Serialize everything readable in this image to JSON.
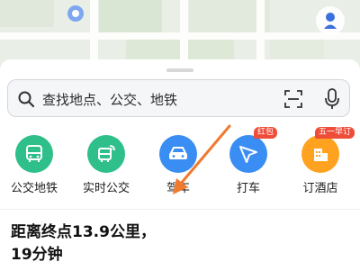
{
  "search": {
    "placeholder": "查找地点、公交、地铁"
  },
  "actions": [
    {
      "label": "公交地铁",
      "icon": "bus-icon",
      "color": "#2fbf8b"
    },
    {
      "label": "实时公交",
      "icon": "realtime-bus-icon",
      "color": "#2fbf8b"
    },
    {
      "label": "驾车",
      "icon": "car-icon",
      "color": "#3a8df2"
    },
    {
      "label": "打车",
      "icon": "taxi-icon",
      "color": "#3a8df2",
      "badge": "红包",
      "badge_color": "#ee4d3a"
    },
    {
      "label": "订酒店",
      "icon": "hotel-icon",
      "color": "#ffa21f",
      "badge": "五一早订",
      "badge_color": "#ee4d3a"
    }
  ],
  "trip": {
    "line1": "距离终点13.9公里，",
    "line2": "19分钟"
  },
  "colors": {
    "accent_green": "#2fbf8b",
    "accent_blue": "#3a8df2",
    "accent_orange": "#ffa21f",
    "arrow": "#f07a2e"
  }
}
